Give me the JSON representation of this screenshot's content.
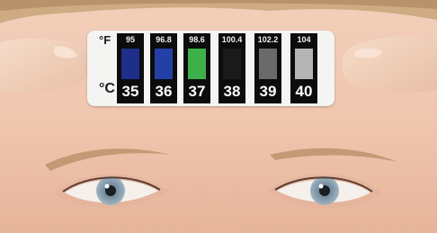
{
  "thermometer": {
    "fahrenheit_unit": "°F",
    "celsius_unit": "°C",
    "readings": [
      {
        "f": "95",
        "c": "35",
        "color": "#1d2f8a"
      },
      {
        "f": "96.8",
        "c": "36",
        "color": "#2440a6"
      },
      {
        "f": "98.6",
        "c": "37",
        "color": "#3db04a"
      },
      {
        "f": "100.4",
        "c": "38",
        "color": "#1a1a1a"
      },
      {
        "f": "102.2",
        "c": "39",
        "color": "#6a6a6a"
      },
      {
        "f": "104",
        "c": "40",
        "color": "#b4b4b4"
      }
    ]
  },
  "colors": {
    "skin": "#f0c9b3",
    "hair": "#c9a47a",
    "iris": "#8da3b3"
  }
}
